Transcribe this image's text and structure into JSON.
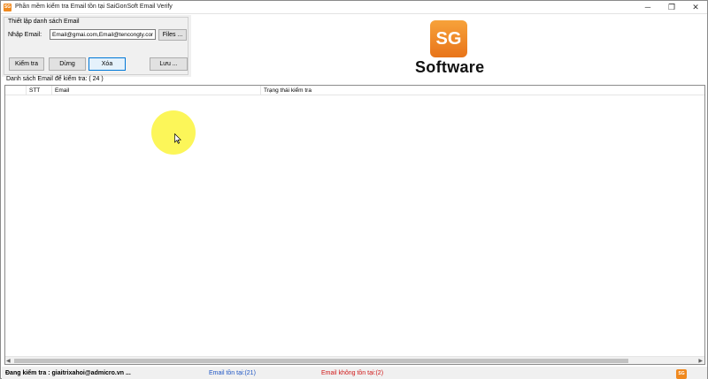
{
  "window": {
    "title": "Phần mềm kiểm tra Email tồn tại SaiGonSoft Email Verify",
    "icon_name": "app-icon",
    "controls": {
      "minimize": "─",
      "maximize": "❐",
      "close": "✕"
    }
  },
  "settings": {
    "group_title": "Thiết lập danh sách Email",
    "email_label": "Nhập Email:",
    "email_value": "Email@gmai.com,Email@tencongty.com",
    "files_button": "Files ..."
  },
  "toolbar": {
    "check_button": "Kiểm tra",
    "stop_button": "Dừng",
    "delete_button": "Xóa",
    "save_button": "Lưu ..."
  },
  "logo": {
    "mark": "SG",
    "text": "Software"
  },
  "list": {
    "caption": "Danh sách Email để kiểm tra: ( 24 )",
    "columns": [
      "",
      "STT",
      "Email",
      "Trạng thái kiểm tra"
    ],
    "rows": []
  },
  "status": {
    "current": "Đang kiểm tra : giaitrixahoi@admicro.vn ...",
    "exist": "Email tồn tại:(21)",
    "not_exist": "Email không tồn tại:(2)",
    "tray_logo": "SG"
  },
  "colors": {
    "accent_orange": "#f0891e",
    "exist_blue": "#1f56c4",
    "not_exist_red": "#d01818",
    "cursor_highlight": "#fcf53c"
  }
}
